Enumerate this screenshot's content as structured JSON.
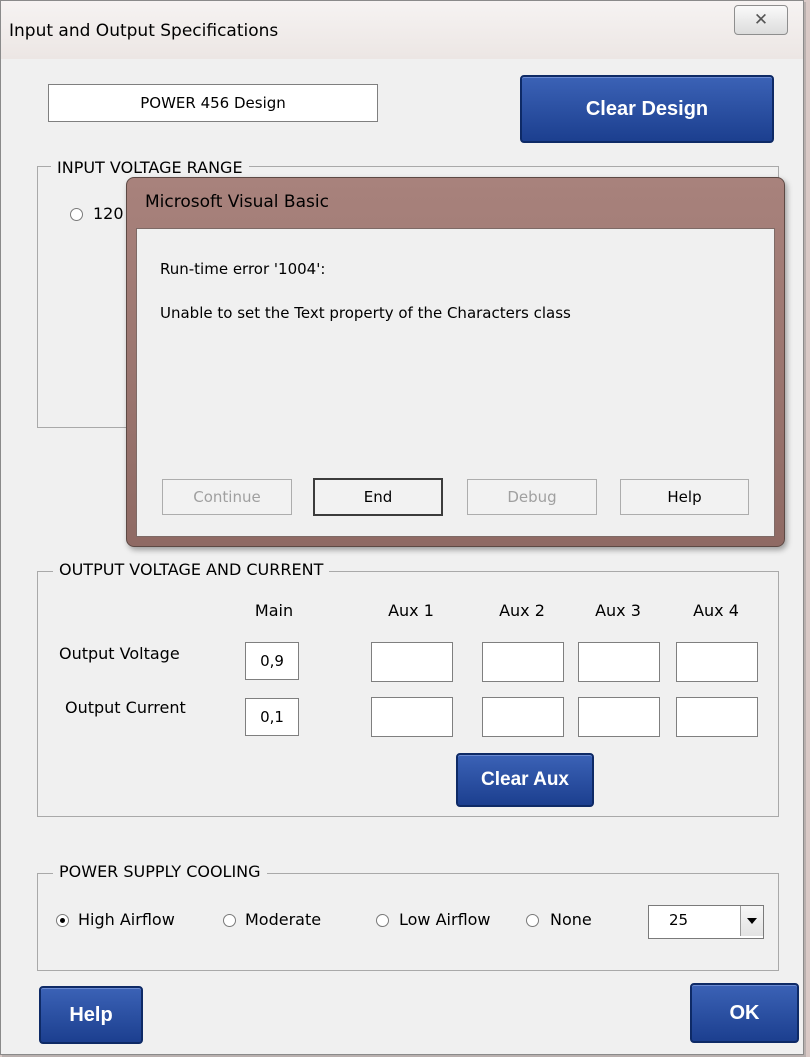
{
  "window": {
    "title": "Input and Output Specifications",
    "close_glyph": "✕"
  },
  "design": {
    "name_value": "POWER 456 Design",
    "clear_design_label": "Clear Design"
  },
  "input_voltage": {
    "legend": "INPUT VOLTAGE RANGE",
    "first_option_visible": "120"
  },
  "output": {
    "legend": "OUTPUT VOLTAGE AND CURRENT",
    "columns": [
      "Main",
      "Aux 1",
      "Aux 2",
      "Aux 3",
      "Aux 4"
    ],
    "voltage_label": "Output Voltage",
    "current_label": "Output Current",
    "voltage_values": [
      "0,9",
      "",
      "",
      "",
      ""
    ],
    "current_values": [
      "0,1",
      "",
      "",
      "",
      ""
    ],
    "clear_aux_label": "Clear Aux"
  },
  "cooling": {
    "legend": "POWER SUPPLY COOLING",
    "options": [
      "High Airflow",
      "Moderate",
      "Low Airflow",
      "None"
    ],
    "selected": "High Airflow",
    "combo_value": "25"
  },
  "footer": {
    "help_label": "Help",
    "ok_label": "OK"
  },
  "error_dialog": {
    "title": "Microsoft Visual Basic",
    "error_line": "Run-time error '1004':",
    "message": "Unable to set the Text property of the Characters class",
    "buttons": {
      "continue": "Continue",
      "end": "End",
      "debug": "Debug",
      "help": "Help"
    }
  },
  "colors": {
    "blue_button": "#1c3f8f",
    "dialog_frame": "#8f6a64",
    "form_background": "#f0f0f0"
  }
}
